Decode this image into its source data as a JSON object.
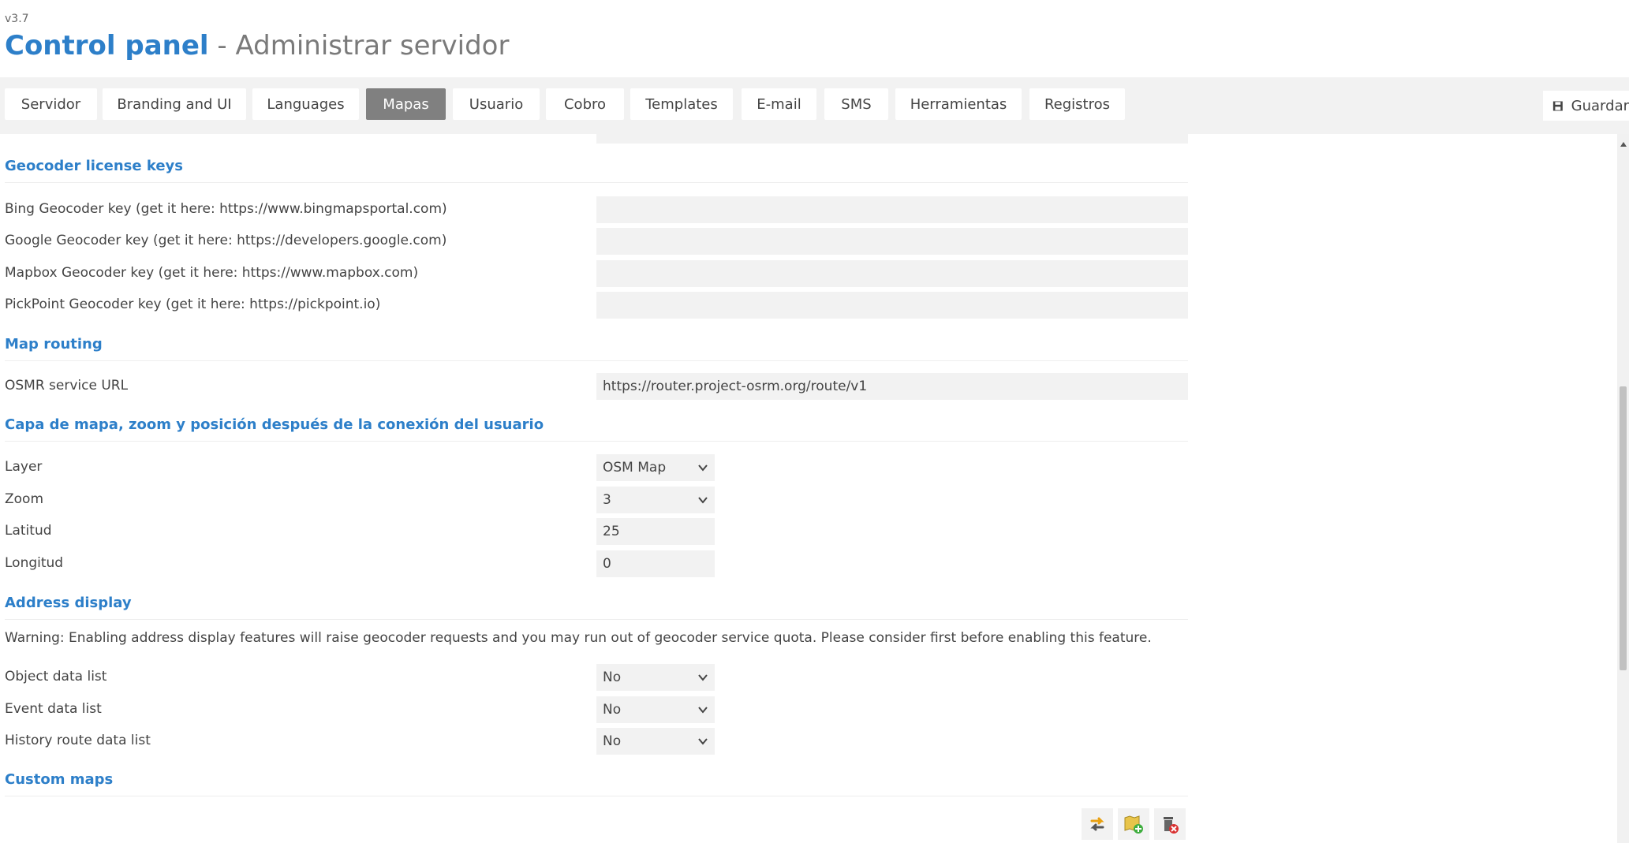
{
  "header": {
    "version": "v3.7",
    "title_bold": "Control panel",
    "title_rest": " - Administrar servidor"
  },
  "tabs": [
    {
      "label": "Servidor"
    },
    {
      "label": "Branding and UI"
    },
    {
      "label": "Languages"
    },
    {
      "label": "Mapas",
      "active": true
    },
    {
      "label": "Usuario"
    },
    {
      "label": "Cobro"
    },
    {
      "label": "Templates"
    },
    {
      "label": "E-mail"
    },
    {
      "label": "SMS"
    },
    {
      "label": "Herramientas"
    },
    {
      "label": "Registros"
    }
  ],
  "toolbar": {
    "save_label": "Guardar"
  },
  "geocoder": {
    "heading": "Geocoder license keys",
    "bing_label": "Bing Geocoder key (get it here: https://www.bingmapsportal.com)",
    "bing_value": "",
    "google_label": "Google Geocoder key (get it here: https://developers.google.com)",
    "google_value": "",
    "mapbox_label": "Mapbox Geocoder key (get it here: https://www.mapbox.com)",
    "mapbox_value": "",
    "pickpoint_label": "PickPoint Geocoder key (get it here: https://pickpoint.io)",
    "pickpoint_value": ""
  },
  "routing": {
    "heading": "Map routing",
    "osmr_label": "OSMR service URL",
    "osmr_value": "https://router.project-osrm.org/route/v1"
  },
  "map_layer": {
    "heading": "Capa de mapa, zoom y posición después de la conexión del usuario",
    "layer_label": "Layer",
    "layer_value": "OSM Map",
    "zoom_label": "Zoom",
    "zoom_value": "3",
    "lat_label": "Latitud",
    "lat_value": "25",
    "lng_label": "Longitud",
    "lng_value": "0"
  },
  "address": {
    "heading": "Address display",
    "warning": "Warning: Enabling address display features will raise geocoder requests and you may run out of geocoder service quota. Please consider first before enabling this feature.",
    "object_label": "Object data list",
    "object_value": "No",
    "event_label": "Event data list",
    "event_value": "No",
    "history_label": "History route data list",
    "history_value": "No"
  },
  "custom_maps": {
    "heading": "Custom maps",
    "icons": [
      "reload-icon",
      "add-map-icon",
      "delete-icon"
    ]
  },
  "colors": {
    "accent": "#2d7fc9",
    "active_tab": "#808080",
    "input_bg": "#f2f2f2"
  }
}
